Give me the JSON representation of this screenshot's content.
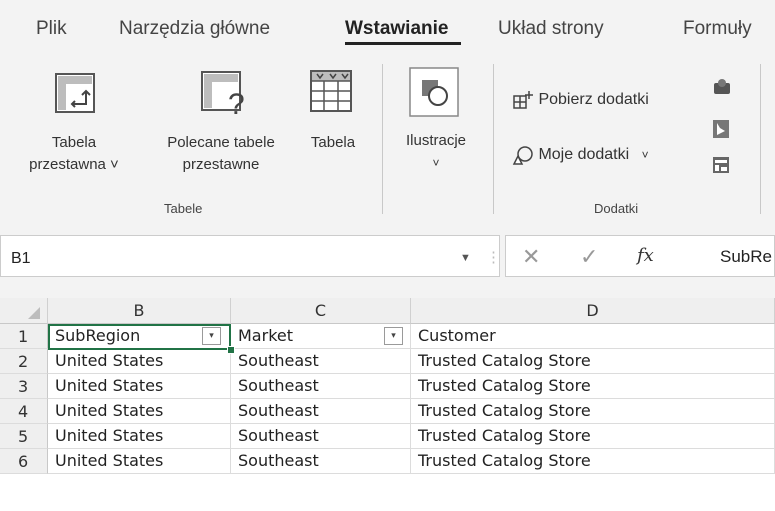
{
  "tabs": [
    "Plik",
    "Narzędzia główne",
    "Wstawianie",
    "Układ strony",
    "Formuły"
  ],
  "ribbon": {
    "tables_group": {
      "label": "Tabele",
      "pivot": {
        "line1": "Tabela",
        "line2": "przestawna ˅"
      },
      "recommended": {
        "line1": "Polecane tabele",
        "line2": "przestawne"
      },
      "table": "Tabela"
    },
    "illustrations": {
      "label": "Ilustracje",
      "chevron": "˅"
    },
    "addins_group": {
      "label": "Dodatki",
      "get_addins": "Pobierz dodatki",
      "my_addins": "Moje dodatki",
      "my_chevron": "˅"
    }
  },
  "formula_bar": {
    "name_box": "B1",
    "cancel": "✕",
    "enter": "✓",
    "fx": "fx",
    "content": "SubRe"
  },
  "sheet": {
    "columns": [
      "B",
      "C",
      "D"
    ],
    "headers": [
      "SubRegion",
      "Market",
      "Customer"
    ],
    "filter_arrow": "▾",
    "rows": [
      {
        "n": "1"
      },
      {
        "n": "2",
        "cells": [
          "United States",
          "Southeast",
          "Trusted Catalog Store"
        ]
      },
      {
        "n": "3",
        "cells": [
          "United States",
          "Southeast",
          "Trusted Catalog Store"
        ]
      },
      {
        "n": "4",
        "cells": [
          "United States",
          "Southeast",
          "Trusted Catalog Store"
        ]
      },
      {
        "n": "5",
        "cells": [
          "United States",
          "Southeast",
          "Trusted Catalog Store"
        ]
      },
      {
        "n": "6",
        "cells": [
          "United States",
          "Southeast",
          "Trusted Catalog Store"
        ]
      }
    ]
  },
  "colors": {
    "accent": "#217346",
    "ribbon_bg": "#f3f3f3"
  }
}
